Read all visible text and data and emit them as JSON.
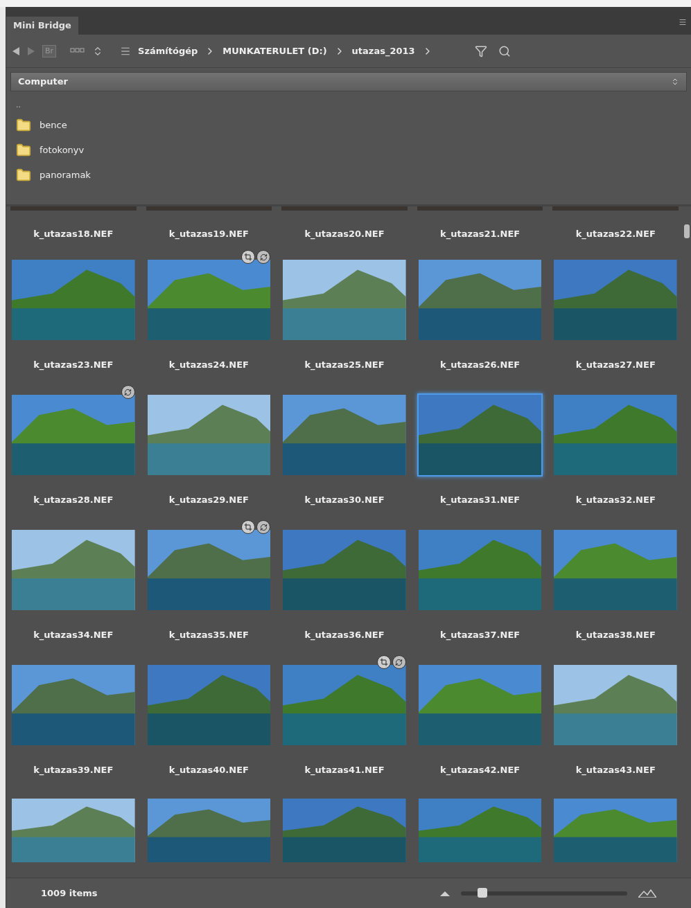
{
  "panel": {
    "tab": "Mini Bridge"
  },
  "toolbar": {
    "bridge_button": "Br",
    "breadcrumb": [
      "Számítógép",
      "MUNKATERULET (D:)",
      "utazas_2013"
    ]
  },
  "location": {
    "value": "Computer"
  },
  "folders": {
    "parent": "..",
    "items": [
      "bence",
      "fotokonyv",
      "panoramak"
    ]
  },
  "top_labels": [
    "k_utazas18.NEF",
    "k_utazas19.NEF",
    "k_utazas20.NEF",
    "k_utazas21.NEF",
    "k_utazas22.NEF"
  ],
  "rows": [
    {
      "items": [
        {
          "name": "k_utazas23.NEF",
          "selected": false,
          "cropped": false,
          "adjusted": false
        },
        {
          "name": "k_utazas24.NEF",
          "selected": false,
          "cropped": true,
          "adjusted": true
        },
        {
          "name": "k_utazas25.NEF",
          "selected": false,
          "cropped": false,
          "adjusted": false
        },
        {
          "name": "k_utazas26.NEF",
          "selected": false,
          "cropped": false,
          "adjusted": false
        },
        {
          "name": "k_utazas27.NEF",
          "selected": false,
          "cropped": false,
          "adjusted": false
        }
      ]
    },
    {
      "items": [
        {
          "name": "k_utazas28.NEF",
          "selected": false,
          "cropped": false,
          "adjusted": true
        },
        {
          "name": "k_utazas29.NEF",
          "selected": false,
          "cropped": false,
          "adjusted": false
        },
        {
          "name": "k_utazas30.NEF",
          "selected": false,
          "cropped": false,
          "adjusted": false
        },
        {
          "name": "k_utazas31.NEF",
          "selected": true,
          "cropped": false,
          "adjusted": false
        },
        {
          "name": "k_utazas32.NEF",
          "selected": false,
          "cropped": false,
          "adjusted": false
        }
      ]
    },
    {
      "items": [
        {
          "name": "k_utazas34.NEF",
          "selected": false,
          "cropped": false,
          "adjusted": false
        },
        {
          "name": "k_utazas35.NEF",
          "selected": false,
          "cropped": true,
          "adjusted": true
        },
        {
          "name": "k_utazas36.NEF",
          "selected": false,
          "cropped": false,
          "adjusted": false
        },
        {
          "name": "k_utazas37.NEF",
          "selected": false,
          "cropped": false,
          "adjusted": false
        },
        {
          "name": "k_utazas38.NEF",
          "selected": false,
          "cropped": false,
          "adjusted": false
        }
      ]
    },
    {
      "items": [
        {
          "name": "k_utazas39.NEF",
          "selected": false,
          "cropped": false,
          "adjusted": false
        },
        {
          "name": "k_utazas40.NEF",
          "selected": false,
          "cropped": false,
          "adjusted": false
        },
        {
          "name": "k_utazas41.NEF",
          "selected": false,
          "cropped": true,
          "adjusted": true
        },
        {
          "name": "k_utazas42.NEF",
          "selected": false,
          "cropped": false,
          "adjusted": false
        },
        {
          "name": "k_utazas43.NEF",
          "selected": false,
          "cropped": false,
          "adjusted": false
        }
      ]
    }
  ],
  "status": {
    "count": "1009 items",
    "zoom": {
      "level": 0.13
    }
  }
}
